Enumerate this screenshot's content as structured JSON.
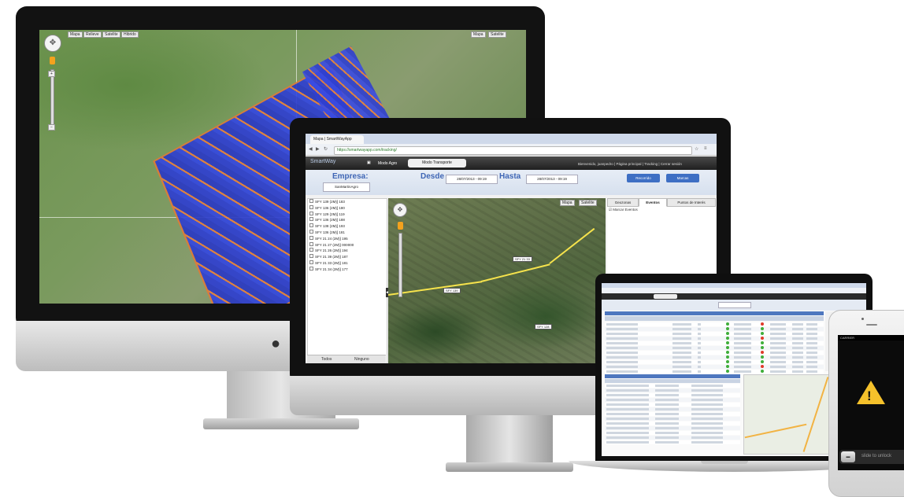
{
  "desktop": {
    "map_controls": [
      "Mapa",
      "Relieve",
      "Satelite",
      "Hibrido"
    ],
    "map_type_buttons": [
      "Mapa",
      "Satelite"
    ]
  },
  "monitor": {
    "browser": {
      "tab_title": "Mapa | SmartWayApp",
      "url": "https://smartwayapp.com/tracking/"
    },
    "app": {
      "brand": "SmartWay",
      "mode_agro": "Modo Agro",
      "mode_transport": "Modo Transporte",
      "user_links": "Bienvenido, juanpedro | Página principal | Tracking | Cerrar sesión"
    },
    "filters": {
      "empresa_label": "Empresa:",
      "empresa_value": "SanMartinAgro",
      "desde_label": "Desde",
      "desde_value": "28/07/2013 - 09:19",
      "hasta_label": "Hasta",
      "hasta_value": "28/07/2013 - 09:19",
      "recorrido_button": "Recorrido",
      "marcas_button": "Marcas"
    },
    "vehicles": [
      "SFY 139 (2M)] 183",
      "SFY 136 (2M)] 180",
      "SFY 129 (2M)] 119",
      "SFY 136 (2M)] 188",
      "SFY 138 (2M)] 193",
      "SFY 136 (2M)] 181",
      "SFY 21 24 (2M)] 195",
      "SFY 21 27 (2M)] 000000",
      "SFY 21 26 (2M)] 194",
      "SFY 21 39 (2M)] 187",
      "SFY 21 33 (2M)] 181",
      "SFY 21 34 (2M)] 177"
    ],
    "list_footer": [
      "Todos",
      "Ninguno"
    ],
    "map_buttons": [
      "Mapa",
      "Satelite"
    ],
    "map_labels": [
      "SFY 21 33",
      "SFY 139",
      "SFY 128"
    ],
    "side_tabs": [
      "Geozonas",
      "Eventos",
      "Puntos de Interés"
    ],
    "side_checkbox": "Marcar Eventos"
  },
  "phone": {
    "carrier": "CARRIER",
    "slide_text": "slide to unlock"
  }
}
